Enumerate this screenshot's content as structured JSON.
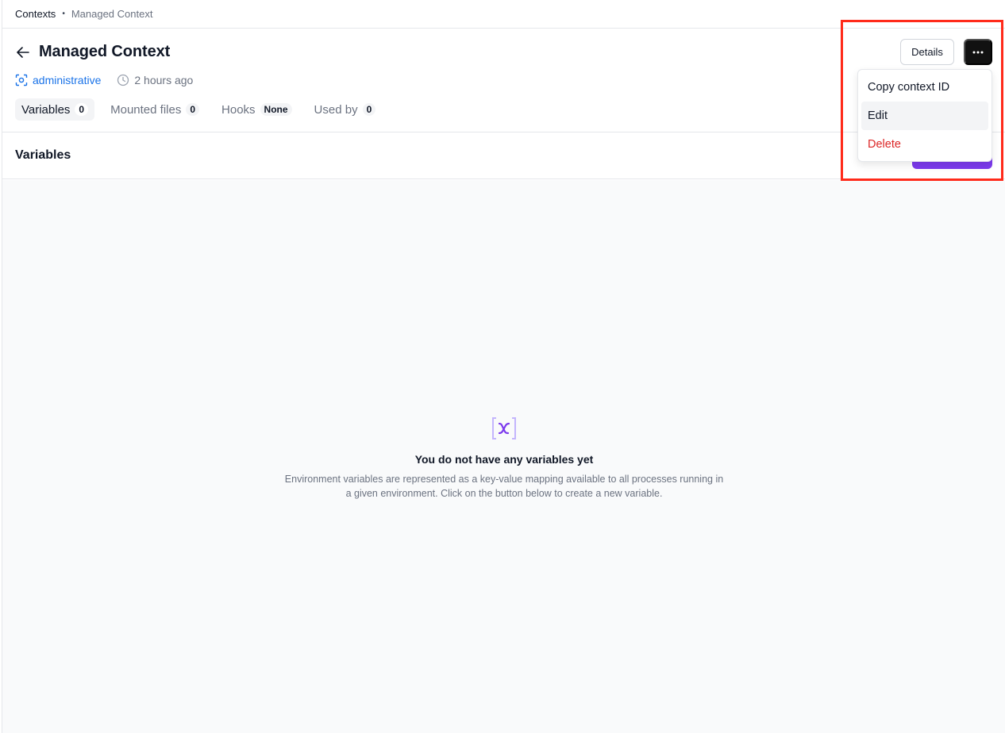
{
  "breadcrumb": {
    "root": "Contexts",
    "separator": "•",
    "current": "Managed Context"
  },
  "header": {
    "title": "Managed Context",
    "space": "administrative",
    "updated": "2 hours ago",
    "details_label": "Details"
  },
  "tabs": [
    {
      "label": "Variables",
      "count": "0",
      "active": true
    },
    {
      "label": "Mounted files",
      "count": "0",
      "active": false
    },
    {
      "label": "Hooks",
      "count": "None",
      "active": false
    },
    {
      "label": "Used by",
      "count": "0",
      "active": false
    }
  ],
  "section": {
    "title": "Variables"
  },
  "empty_state": {
    "icon": "variable-brackets-icon",
    "title": "You do not have any variables yet",
    "description_line1": "Environment variables are represented as a key-value mapping available to all processes running in",
    "description_line2": "a given environment. Click on the button below to create a new variable."
  },
  "menu": {
    "items": [
      {
        "label": "Copy context ID"
      },
      {
        "label": "Edit"
      },
      {
        "label": "Delete"
      }
    ]
  },
  "colors": {
    "accent": "#7c3aed",
    "link": "#1a73e8",
    "danger": "#dc2626",
    "highlight": "#ff2a1a"
  }
}
